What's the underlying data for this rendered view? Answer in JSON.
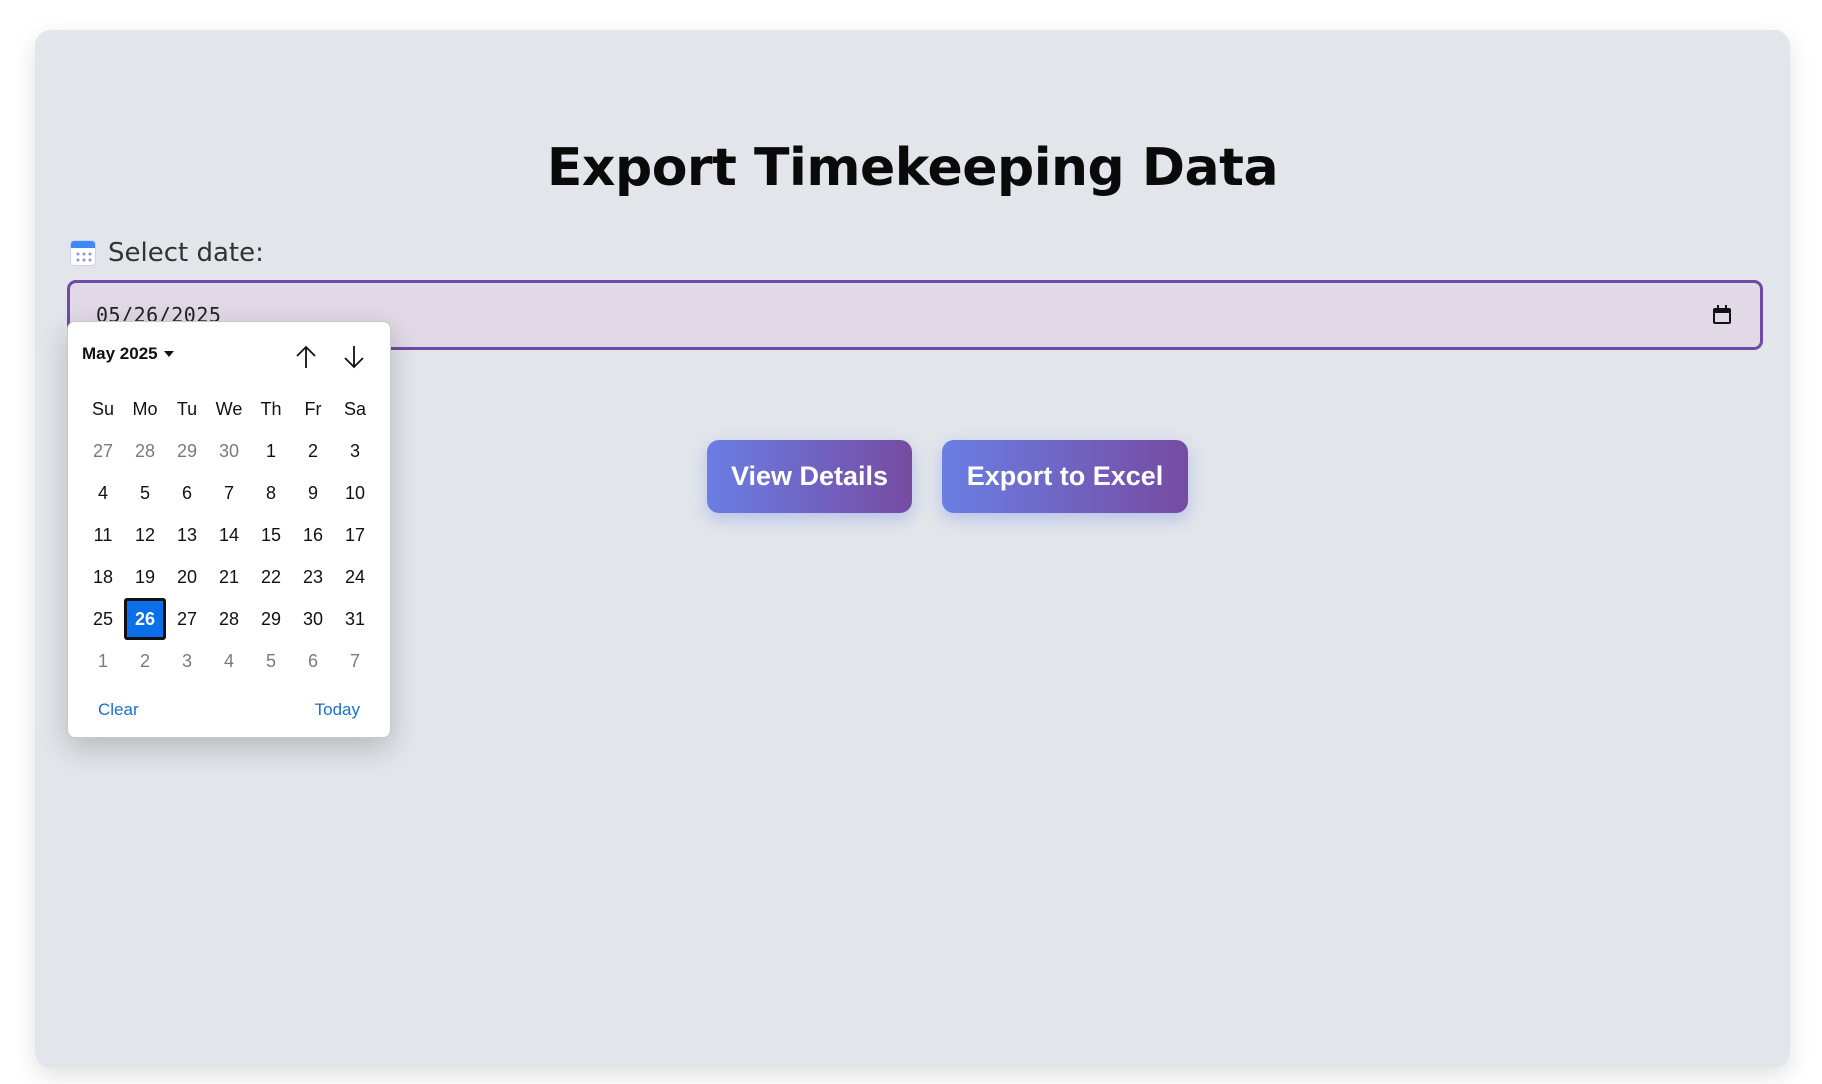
{
  "page": {
    "title": "Export Timekeeping Data"
  },
  "date_field": {
    "label": "Select date:",
    "value": "05/26/2025"
  },
  "buttons": {
    "view_details": "View Details",
    "export_excel": "Export to Excel"
  },
  "colors": {
    "accent_start": "#667eea",
    "accent_end": "#764ba2",
    "selected_day": "#0a6fe8",
    "link": "#1a6fd1"
  },
  "datepicker": {
    "month_label": "May 2025",
    "weekdays": [
      "Su",
      "Mo",
      "Tu",
      "We",
      "Th",
      "Fr",
      "Sa"
    ],
    "weeks": [
      [
        "27",
        "28",
        "29",
        "30",
        "1",
        "2",
        "3"
      ],
      [
        "4",
        "5",
        "6",
        "7",
        "8",
        "9",
        "10"
      ],
      [
        "11",
        "12",
        "13",
        "14",
        "15",
        "16",
        "17"
      ],
      [
        "18",
        "19",
        "20",
        "21",
        "22",
        "23",
        "24"
      ],
      [
        "25",
        "26",
        "27",
        "28",
        "29",
        "30",
        "31"
      ],
      [
        "1",
        "2",
        "3",
        "4",
        "5",
        "6",
        "7"
      ]
    ],
    "selected": "26",
    "clear_label": "Clear",
    "today_label": "Today"
  }
}
